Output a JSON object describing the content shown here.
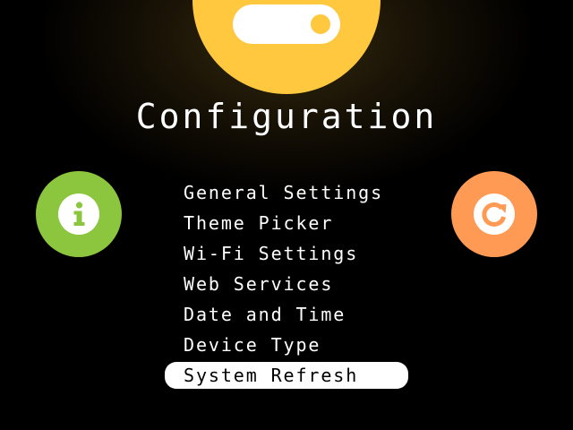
{
  "header": {
    "title": "Configuration",
    "icon": "toggle-switch-icon",
    "accent_color": "#FFC83F"
  },
  "side_buttons": {
    "left": {
      "icon": "info-icon",
      "color": "#8CC63F"
    },
    "right": {
      "icon": "refresh-icon",
      "color": "#FF9A55"
    }
  },
  "menu": {
    "items": [
      {
        "label": "General Settings",
        "selected": false
      },
      {
        "label": "Theme Picker",
        "selected": false
      },
      {
        "label": "Wi-Fi Settings",
        "selected": false
      },
      {
        "label": "Web Services",
        "selected": false
      },
      {
        "label": "Date and Time",
        "selected": false
      },
      {
        "label": "Device Type",
        "selected": false
      },
      {
        "label": "System Refresh",
        "selected": true
      }
    ],
    "selected_index": 6
  }
}
